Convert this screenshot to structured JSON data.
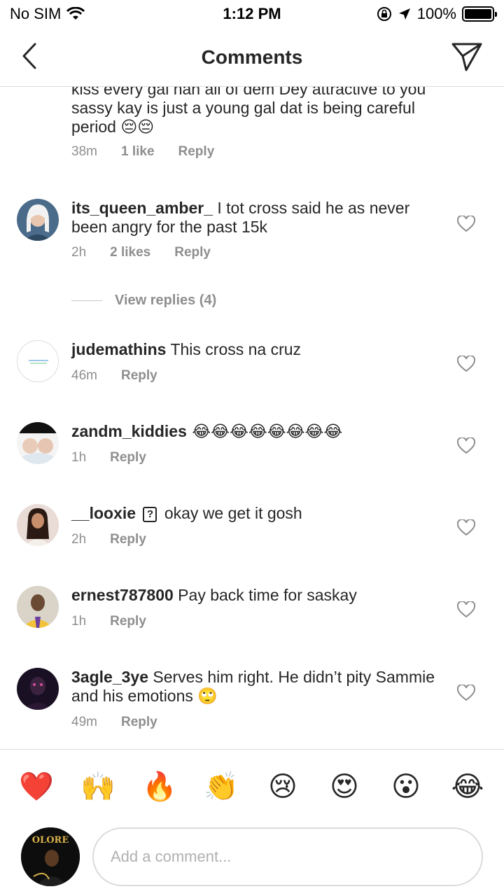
{
  "status_bar": {
    "carrier": "No SIM",
    "time": "1:12 PM",
    "battery": "100%"
  },
  "header": {
    "title": "Comments"
  },
  "comments": [
    {
      "text": "kiss every gal han all of dem Dey attractive to you sassy kay is just a young gal dat is being careful period 😔😔",
      "time": "38m",
      "likes": "1 like",
      "reply": "Reply"
    },
    {
      "user": "its_queen_amber_",
      "text": " I tot cross said he as never been angry for the past 15k",
      "time": "2h",
      "likes": "2 likes",
      "reply": "Reply",
      "view_replies": "View replies (4)"
    },
    {
      "user": "judemathins",
      "text": " This cross na cruz",
      "time": "46m",
      "reply": "Reply"
    },
    {
      "user": "zandm_kiddies",
      "text": " 😂😂😂😂😂😂😂😂",
      "time": "1h",
      "reply": "Reply"
    },
    {
      "user": "__looxie",
      "icon_char": "?",
      "text": "okay we get it gosh",
      "time": "2h",
      "reply": "Reply"
    },
    {
      "user": "ernest787800",
      "text": " Pay back time for saskay",
      "time": "1h",
      "reply": "Reply"
    },
    {
      "user": "3agle_3ye",
      "text": " Serves him right. He didn’t pity Sammie and his emotions 🙄",
      "time": "49m",
      "reply": "Reply"
    }
  ],
  "reactions": [
    "❤️",
    "🙌",
    "🔥",
    "👏",
    "😢",
    "😍",
    "😮",
    "😂"
  ],
  "composer": {
    "placeholder": "Add a comment...",
    "avatar_text": "OLORE"
  },
  "colors": {
    "text": "#262626",
    "meta": "#8e8e8e",
    "divider": "#dbdbdb"
  }
}
